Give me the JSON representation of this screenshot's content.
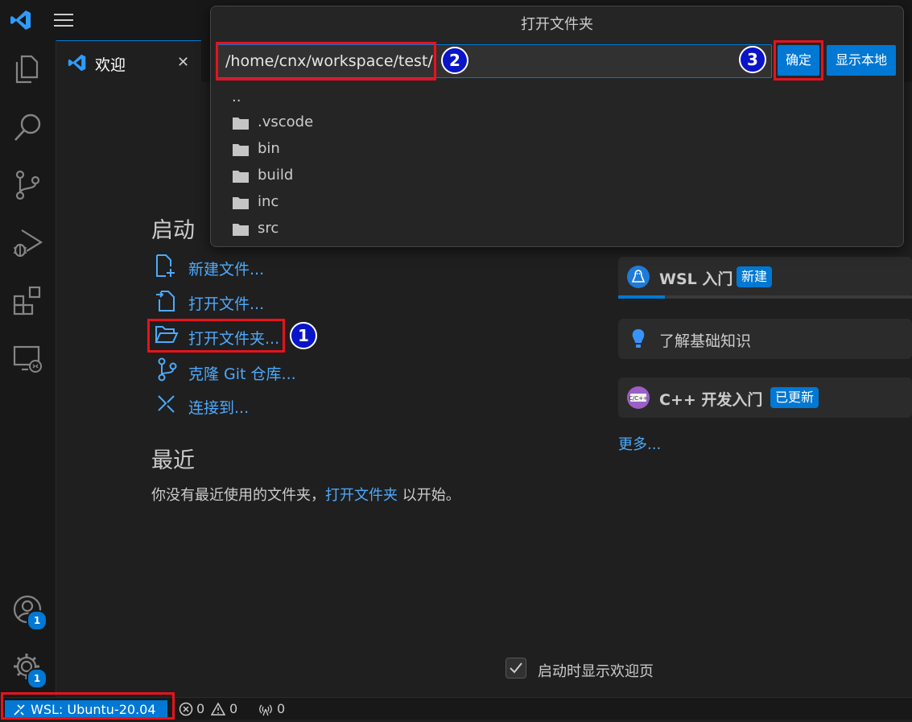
{
  "app": {
    "logo_icon": "vscode-logo-icon",
    "accent": "#0078d4"
  },
  "tab": {
    "label": "欢迎",
    "close": "✕"
  },
  "activity": {
    "items": [
      "explorer-icon",
      "search-icon",
      "source-control-icon",
      "run-debug-icon",
      "extensions-icon",
      "remote-explorer-icon"
    ],
    "account_badge": "1",
    "settings_badge": "1"
  },
  "dialog": {
    "title": "打开文件夹",
    "path_value": "/home/cnx/workspace/test/",
    "ok_label": "确定",
    "show_local_label": "显示本地",
    "parent_entry": "..",
    "folders": [
      ".vscode",
      "bin",
      "build",
      "inc",
      "src"
    ]
  },
  "welcome": {
    "start_title": "启动",
    "start_items": [
      "新建文件...",
      "打开文件...",
      "打开文件夹...",
      "克隆 Git 仓库...",
      "连接到..."
    ],
    "recent_title": "最近",
    "recent_text_before": "你没有最近使用的文件夹，",
    "recent_link": "打开文件夹",
    "recent_text_after": "以开始。",
    "walkthroughs": [
      {
        "title": "WSL 入门",
        "badge": "新建",
        "progress": 0.16
      },
      {
        "title": "了解基础知识",
        "badge": ""
      },
      {
        "title": "C++ 开发入门",
        "badge": "已更新"
      }
    ],
    "more_link": "更多...",
    "show_on_startup": "启动时显示欢迎页"
  },
  "status": {
    "remote": "WSL: Ubuntu-20.04",
    "errors": "0",
    "warnings": "0",
    "ports": "0"
  },
  "annotations": [
    "1",
    "2",
    "3"
  ]
}
